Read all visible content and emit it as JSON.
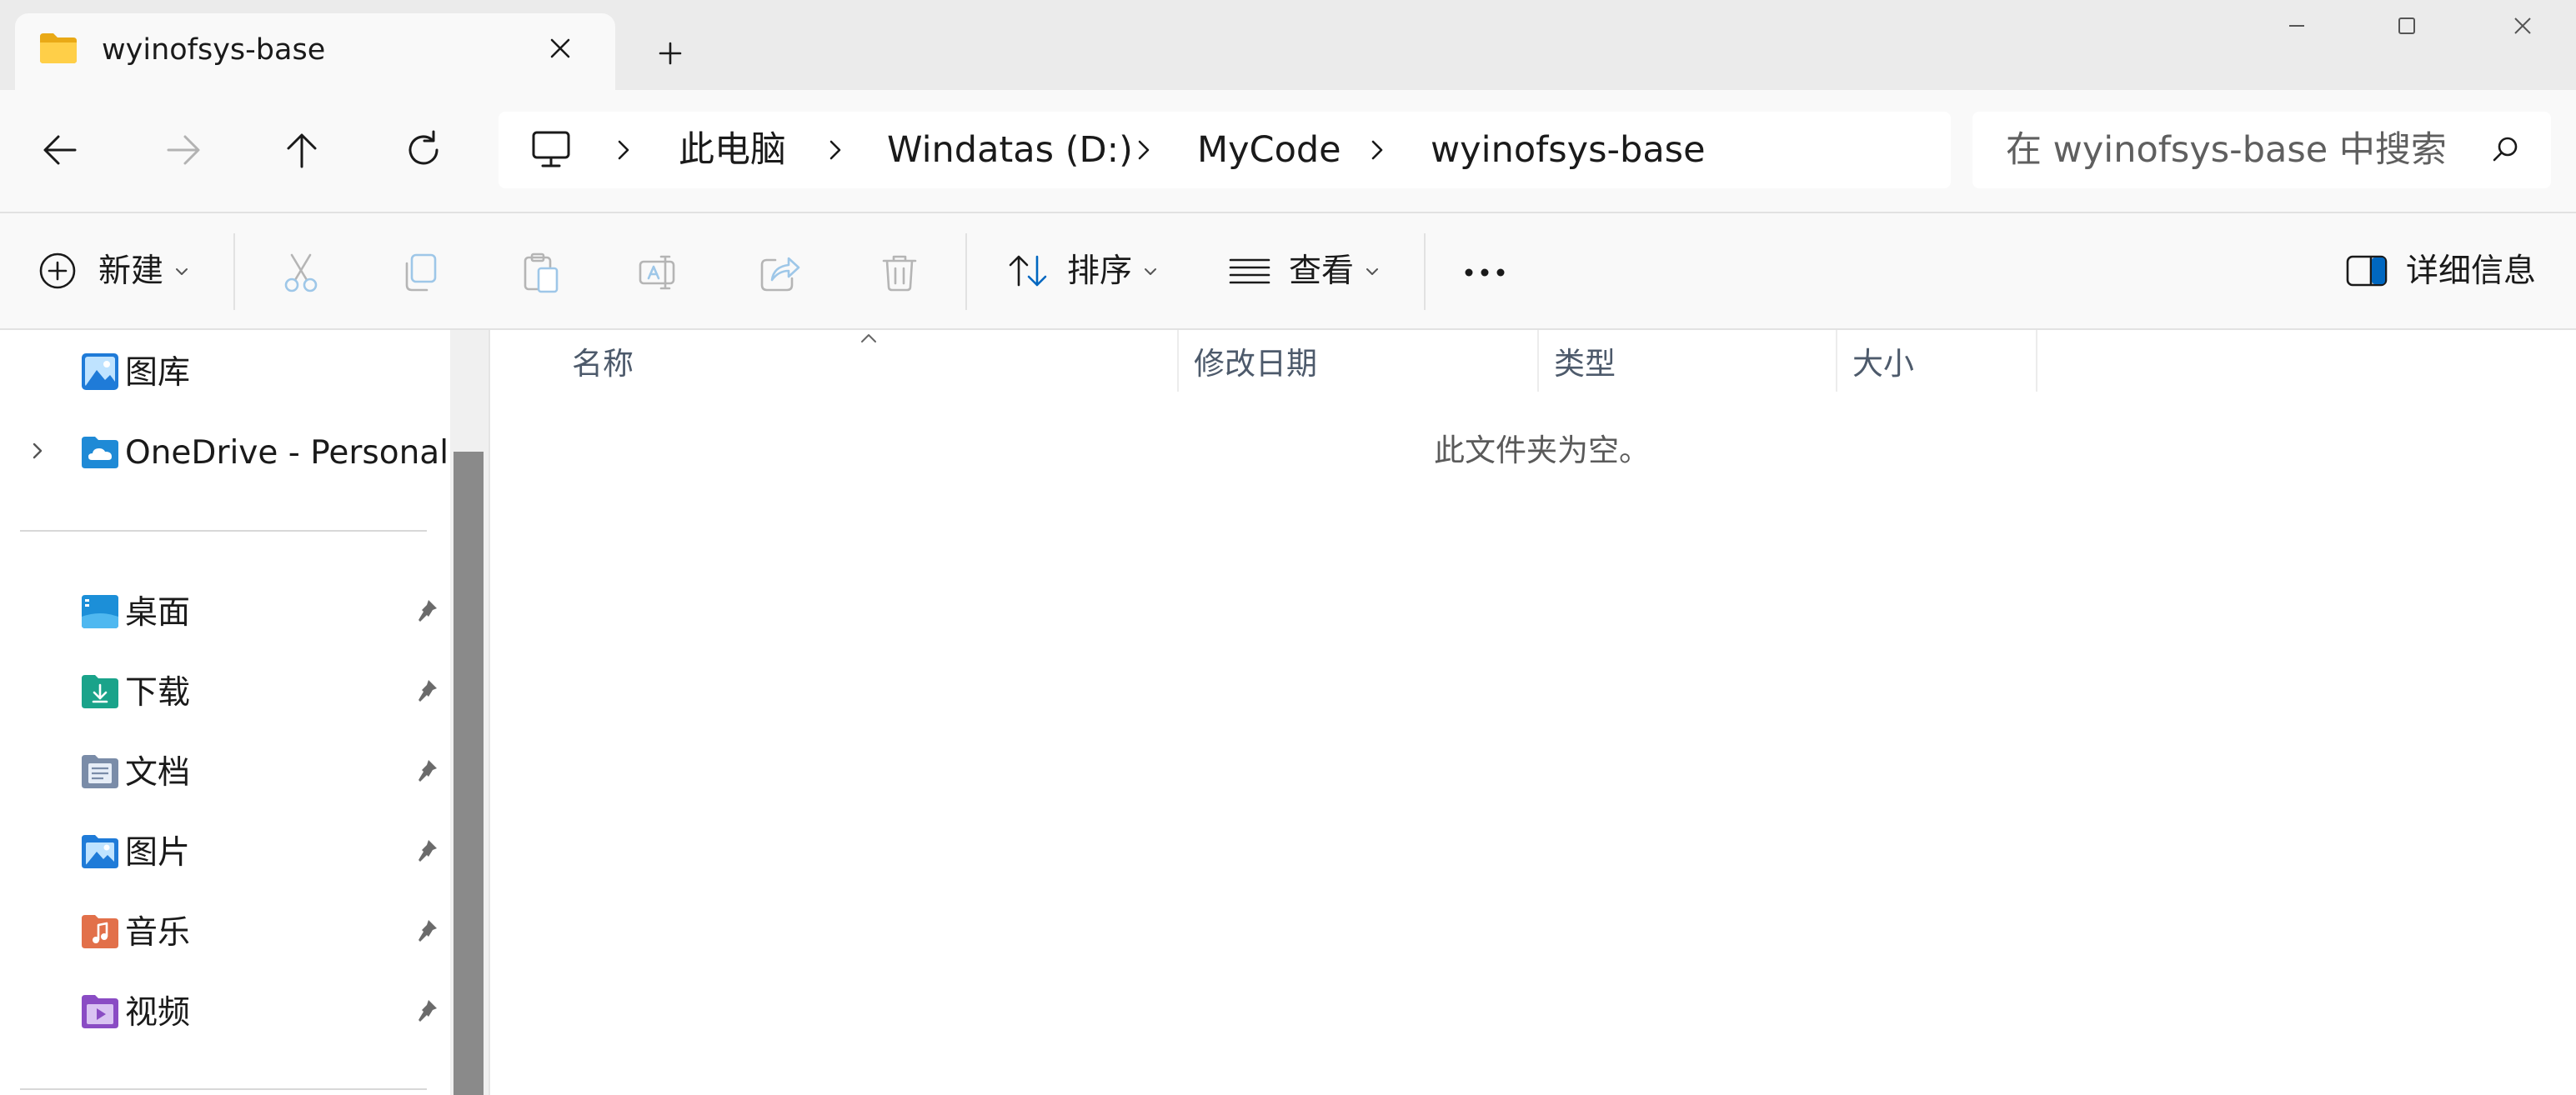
{
  "window": {
    "tab_title": "wyinofsys-base",
    "tab_icon": "folder-icon",
    "accent_color": "#0067c0",
    "folder_color": "#f4c542"
  },
  "address": {
    "root_icon": "computer-icon",
    "crumbs": [
      "此电脑",
      "Windatas (D:)",
      "MyCode",
      "wyinofsys-base"
    ]
  },
  "search": {
    "placeholder": "在 wyinofsys-base 中搜索"
  },
  "toolbar": {
    "new_label": "新建",
    "sort_label": "排序",
    "view_label": "查看",
    "details_label": "详细信息",
    "disabled_actions": [
      "cut-icon",
      "copy-icon",
      "paste-icon",
      "rename-icon",
      "share-icon",
      "delete-icon"
    ]
  },
  "sidebar": {
    "top_items": [
      {
        "label": "图库",
        "icon": "gallery-icon"
      },
      {
        "label": "OneDrive - Personal",
        "icon": "onedrive-icon"
      }
    ],
    "quick_access": [
      {
        "label": "桌面",
        "icon": "desktop-folder-icon"
      },
      {
        "label": "下载",
        "icon": "downloads-folder-icon"
      },
      {
        "label": "文档",
        "icon": "documents-folder-icon"
      },
      {
        "label": "图片",
        "icon": "pictures-folder-icon"
      },
      {
        "label": "音乐",
        "icon": "music-folder-icon"
      },
      {
        "label": "视频",
        "icon": "videos-folder-icon"
      }
    ]
  },
  "content": {
    "columns": [
      "名称",
      "修改日期",
      "类型",
      "大小"
    ],
    "empty_message": "此文件夹为空。"
  }
}
